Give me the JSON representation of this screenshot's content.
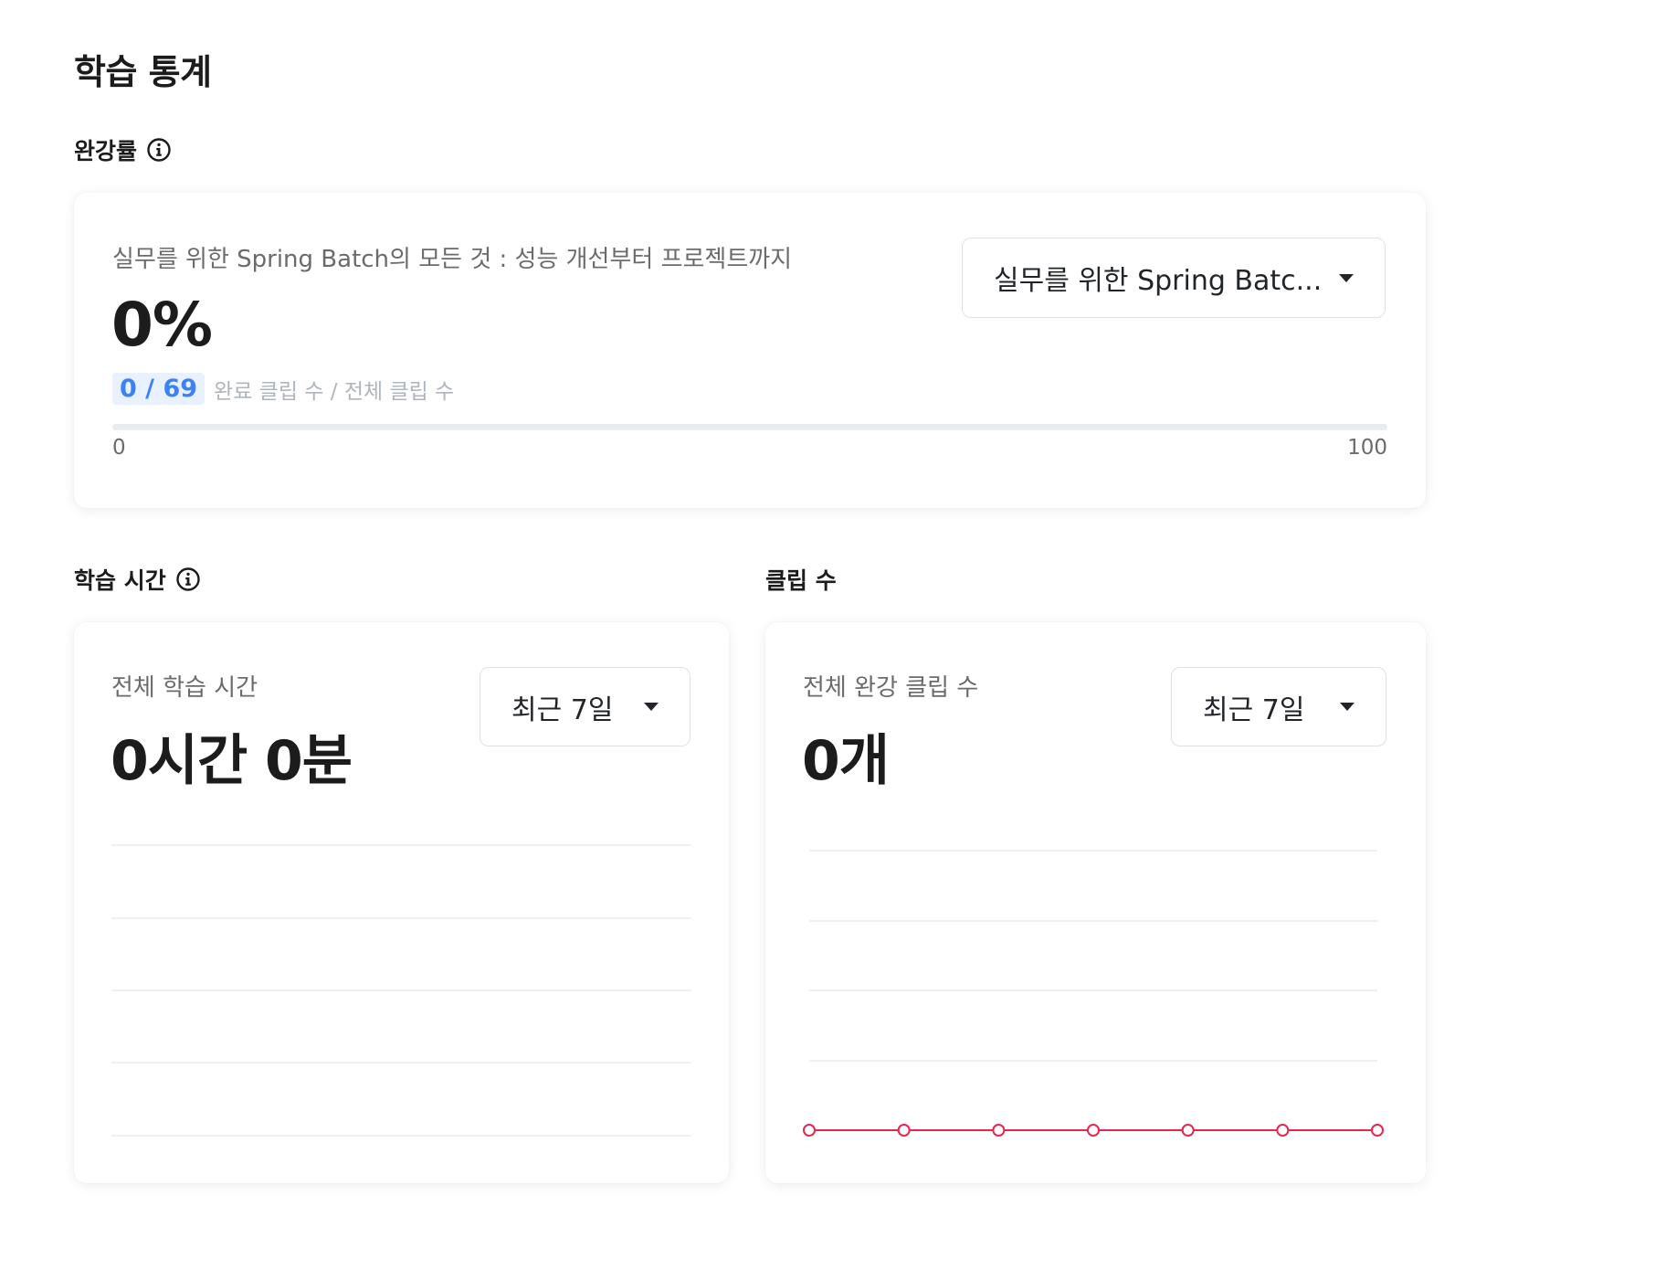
{
  "page_title": "학습 통계",
  "completion": {
    "section_label": "완강률",
    "course_name": "실무를 위한 Spring Batch의 모든 것 : 성능 개선부터 프로젝트까지",
    "percent_label": "0%",
    "course_select_value": "실무를 위한 Spring Batc...",
    "clip_ratio": "0 / 69",
    "clip_caption": "완료 클립 수 / 전체 클립 수",
    "progress_fraction": 0,
    "progress_min": "0",
    "progress_max": "100"
  },
  "study_time": {
    "section_label": "학습 시간",
    "subtitle": "전체 학습 시간",
    "value": "0시간 0분",
    "range_select_value": "최근 7일"
  },
  "clips": {
    "section_label": "클립 수",
    "subtitle": "전체 완강 클립 수",
    "value": "0개",
    "range_select_value": "최근 7일",
    "chart_data": {
      "type": "line",
      "values": [
        0,
        0,
        0,
        0,
        0,
        0,
        0
      ],
      "color": "#e8274f",
      "grid": true
    }
  },
  "colors": {
    "accent": "#3b82f6",
    "line": "#e8274f",
    "grid": "#e9ecef"
  }
}
